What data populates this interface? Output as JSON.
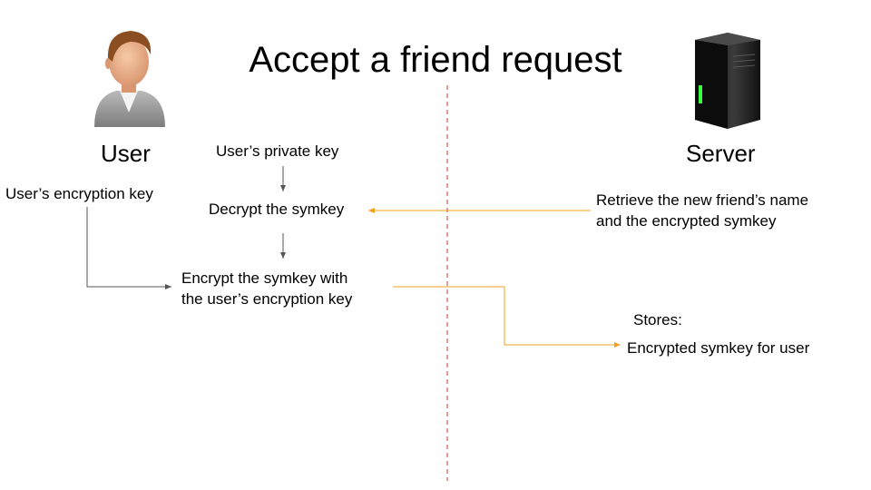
{
  "title": "Accept a friend request",
  "user": {
    "label": "User",
    "encryption_key": "User’s encryption key",
    "private_key": "User’s private key",
    "decrypt_step": "Decrypt the symkey",
    "encrypt_step_line1": "Encrypt the symkey with",
    "encrypt_step_line2": "the user’s encryption key"
  },
  "server": {
    "label": "Server",
    "retrieve_line1": "Retrieve the new friend’s name",
    "retrieve_line2": "and the encrypted symkey",
    "stores_label": "Stores:",
    "stored_item": "Encrypted symkey for user"
  },
  "colors": {
    "divider": "#c0392b",
    "server_arrow": "#f0a020",
    "user_arrow": "#555555"
  },
  "icons": {
    "user": "person-avatar-icon",
    "server": "server-tower-icon"
  }
}
